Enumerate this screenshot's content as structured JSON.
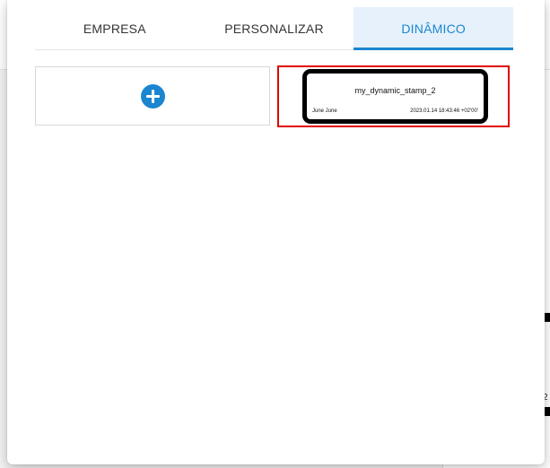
{
  "tabs": [
    {
      "label": "EMPRESA",
      "active": false
    },
    {
      "label": "PERSONALIZAR",
      "active": false
    },
    {
      "label": "DINÂMICO",
      "active": true
    }
  ],
  "add_card": {
    "icon": "plus-circle-icon"
  },
  "stamp": {
    "title": "my_dynamic_stamp_2",
    "author": "June June",
    "timestamp": "2023.01.14 18:43:46 +02'00'"
  },
  "background": {
    "right_edge_text": "2"
  },
  "colors": {
    "accent": "#1a86d0",
    "selection_border": "#e00000",
    "active_tab_bg": "#e6f1fb"
  }
}
